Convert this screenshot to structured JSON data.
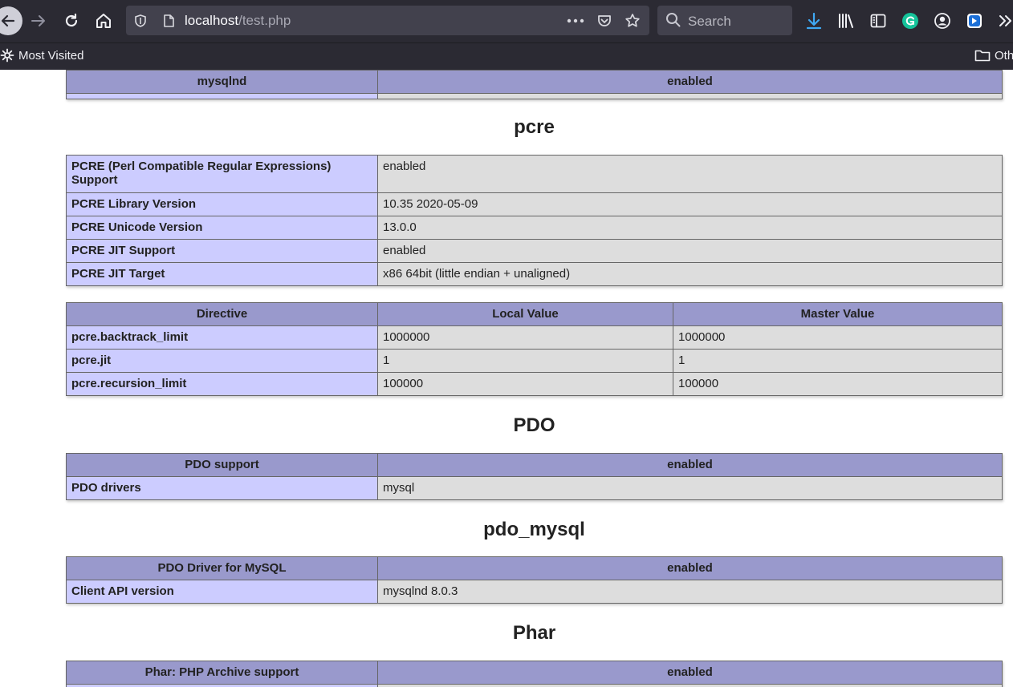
{
  "browser": {
    "url_host": "localhost",
    "url_path": "/test.php",
    "search_placeholder": "Search",
    "bookmarks": {
      "most_visited": "Most Visited",
      "other": "Oth"
    }
  },
  "sections": {
    "mysqlnd_tail": {
      "header_left": "mysqlnd",
      "header_right": "enabled"
    },
    "pcre": {
      "title": "pcre",
      "info_rows": [
        {
          "label": "PCRE (Perl Compatible Regular Expressions) Support",
          "value": "enabled"
        },
        {
          "label": "PCRE Library Version",
          "value": "10.35 2020-05-09"
        },
        {
          "label": "PCRE Unicode Version",
          "value": "13.0.0"
        },
        {
          "label": "PCRE JIT Support",
          "value": "enabled"
        },
        {
          "label": "PCRE JIT Target",
          "value": "x86 64bit (little endian + unaligned)"
        }
      ],
      "directive_headers": {
        "directive": "Directive",
        "local": "Local Value",
        "master": "Master Value"
      },
      "directives": [
        {
          "name": "pcre.backtrack_limit",
          "local": "1000000",
          "master": "1000000"
        },
        {
          "name": "pcre.jit",
          "local": "1",
          "master": "1"
        },
        {
          "name": "pcre.recursion_limit",
          "local": "100000",
          "master": "100000"
        }
      ]
    },
    "pdo": {
      "title": "PDO",
      "header_left": "PDO support",
      "header_right": "enabled",
      "rows": [
        {
          "label": "PDO drivers",
          "value": "mysql"
        }
      ]
    },
    "pdo_mysql": {
      "title": "pdo_mysql",
      "header_left": "PDO Driver for MySQL",
      "header_right": "enabled",
      "rows": [
        {
          "label": "Client API version",
          "value": "mysqlnd 8.0.3"
        }
      ]
    },
    "phar": {
      "title": "Phar",
      "header_left": "Phar: PHP Archive support",
      "header_right": "enabled"
    }
  },
  "colors": {
    "header": "#9999cc",
    "label_cell": "#ccccff",
    "value_cell": "#dddddd",
    "chrome": "#2b2a33",
    "url_field": "#42414d",
    "download_accent": "#3fa9f5",
    "grammarly": "#15c39a"
  }
}
